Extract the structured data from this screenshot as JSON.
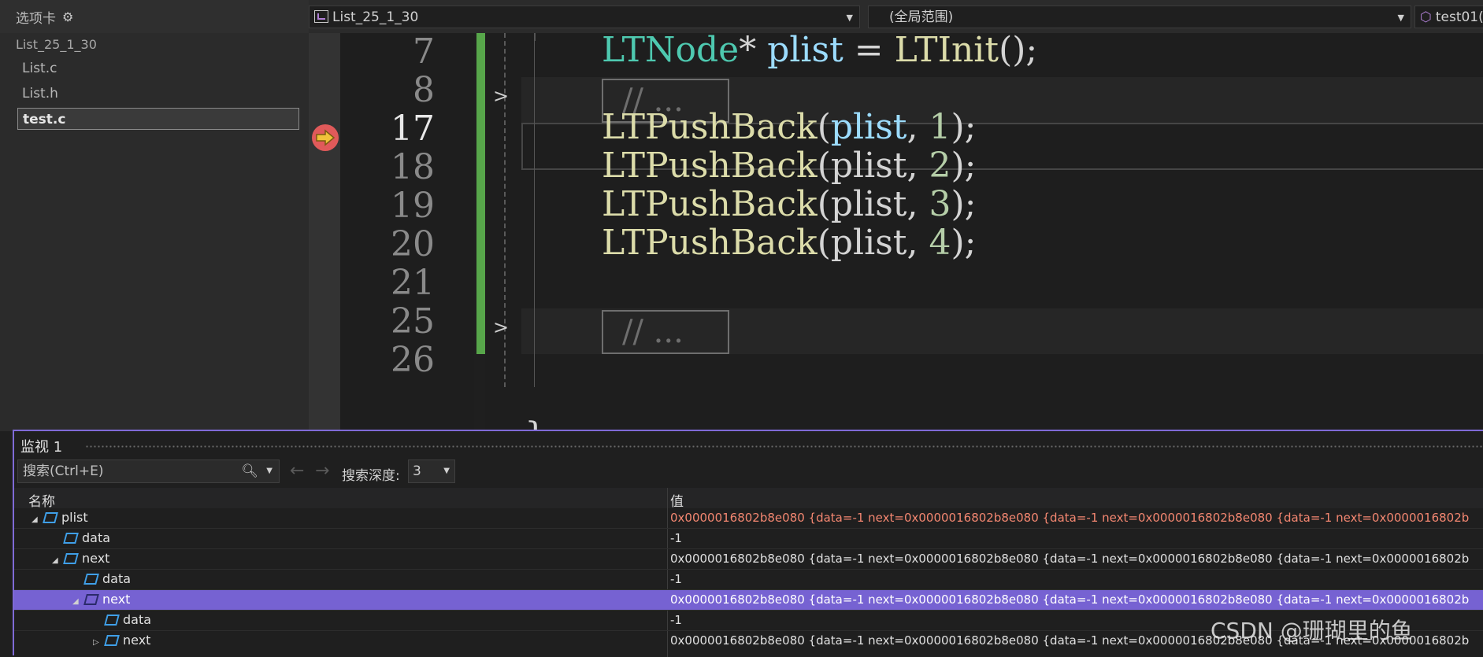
{
  "tabs": {
    "header": "选项卡",
    "group": "List_25_1_30",
    "files": [
      "List.c",
      "List.h",
      "test.c"
    ],
    "active_file": "test.c"
  },
  "nav": {
    "project": "List_25_1_30",
    "scope": "(全局范围)",
    "function": "test01("
  },
  "editor": {
    "line_numbers": [
      "7",
      "8",
      "17",
      "18",
      "19",
      "20",
      "21",
      "25",
      "26"
    ],
    "current_line": "17",
    "lines": [
      {
        "type": "LTNode",
        "ptr": "*",
        "var": "plist",
        "op": " = ",
        "fn": "LTInit",
        "rest": "();"
      },
      {
        "collapsed": "// ..."
      },
      {
        "fn": "LTPushBack",
        "open": "(",
        "var": "plist",
        "sep": ", ",
        "num": "1",
        "close": ");"
      },
      {
        "fn": "LTPushBack",
        "open": "(",
        "var": "plist",
        "sep": ", ",
        "num": "2",
        "close": ");"
      },
      {
        "fn": "LTPushBack",
        "open": "(",
        "var": "plist",
        "sep": ", ",
        "num": "3",
        "close": ");"
      },
      {
        "fn": "LTPushBack",
        "open": "(",
        "var": "plist",
        "sep": ", ",
        "num": "4",
        "close": ");"
      },
      {
        "collapsed": "// ..."
      },
      {},
      {
        "brace": "}"
      }
    ]
  },
  "watch": {
    "title": "监视 1",
    "search_placeholder": "搜索(Ctrl+E)",
    "depth_label": "搜索深度:",
    "depth_value": "3",
    "col_name": "名称",
    "col_value": "值",
    "rows": [
      {
        "name": "plist",
        "value": "0x0000016802b8e080 {data=-1 next=0x0000016802b8e080 {data=-1 next=0x0000016802b8e080 {data=-1 next=0x0000016802b",
        "changed": true,
        "selected": false
      },
      {
        "name": "data",
        "value": "-1",
        "changed": false,
        "selected": false
      },
      {
        "name": "next",
        "value": "0x0000016802b8e080 {data=-1 next=0x0000016802b8e080 {data=-1 next=0x0000016802b8e080 {data=-1 next=0x0000016802b",
        "changed": false,
        "selected": false
      },
      {
        "name": "data",
        "value": "-1",
        "changed": false,
        "selected": false
      },
      {
        "name": "next",
        "value": "0x0000016802b8e080 {data=-1 next=0x0000016802b8e080 {data=-1 next=0x0000016802b8e080 {data=-1 next=0x0000016802b",
        "changed": false,
        "selected": true
      },
      {
        "name": "data",
        "value": "-1",
        "changed": false,
        "selected": false
      },
      {
        "name": "next",
        "value": "0x0000016802b8e080 {data=-1 next=0x0000016802b8e080 {data=-1 next=0x0000016802b8e080 {data=-1 next=0x0000016802b",
        "changed": false,
        "selected": false
      }
    ]
  },
  "watermark": "CSDN @珊瑚里的鱼"
}
